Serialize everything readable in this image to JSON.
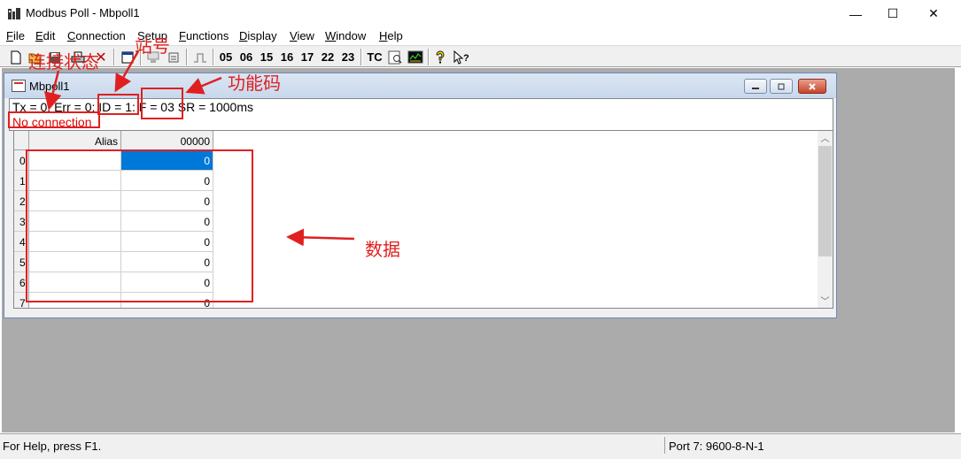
{
  "window": {
    "title": "Modbus Poll - Mbpoll1",
    "controls": {
      "minimize": "—",
      "maximize": "☐",
      "close": "✕"
    }
  },
  "menu": [
    "File",
    "Edit",
    "Connection",
    "Setup",
    "Functions",
    "Display",
    "View",
    "Window",
    "Help"
  ],
  "toolbar": {
    "function_codes": [
      "05",
      "06",
      "15",
      "16",
      "17",
      "22",
      "23"
    ],
    "tc_label": "TC",
    "icons": [
      "new-file-icon",
      "open-folder-icon",
      "save-icon",
      "print-icon",
      "delete-icon",
      "window-icon",
      "connect-icon",
      "disconnect-icon",
      "pulse-icon",
      "read-icon",
      "monitor-icon",
      "help-icon",
      "context-help-icon"
    ]
  },
  "child_window": {
    "title": "Mbpoll1",
    "status_line": {
      "tx": "Tx = 0:",
      "err": "Err = 0:",
      "id": "ID = 1:",
      "f": "F = 03",
      "sr": "SR = 1000ms"
    },
    "connection_status": "No connection",
    "grid": {
      "columns": [
        "Alias",
        "00000"
      ],
      "rows": [
        {
          "index": "0",
          "alias": "",
          "value": "0"
        },
        {
          "index": "1",
          "alias": "",
          "value": "0"
        },
        {
          "index": "2",
          "alias": "",
          "value": "0"
        },
        {
          "index": "3",
          "alias": "",
          "value": "0"
        },
        {
          "index": "4",
          "alias": "",
          "value": "0"
        },
        {
          "index": "5",
          "alias": "",
          "value": "0"
        },
        {
          "index": "6",
          "alias": "",
          "value": "0"
        },
        {
          "index": "7",
          "alias": "",
          "value": "0"
        }
      ]
    }
  },
  "statusbar": {
    "help": "For Help, press F1.",
    "port": "Port 7: 9600-8-N-1"
  },
  "annotations": {
    "connection_state": "连接状态",
    "station_id": "站号",
    "function_code": "功能码",
    "data": "数据",
    "color": "#e02020"
  }
}
